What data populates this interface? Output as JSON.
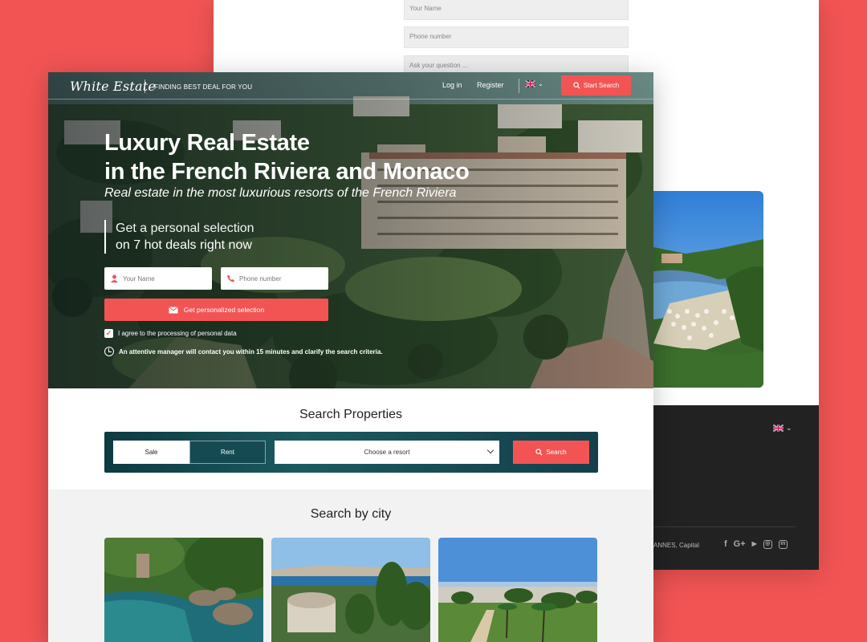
{
  "back_page": {
    "form": {
      "name_placeholder": "Your Name",
      "phone_placeholder": "Phone number",
      "question_placeholder": "Ask your question ..."
    },
    "footer": {
      "address_fragment": "ANNES, Capital",
      "social_icons": [
        "facebook-icon",
        "google-plus-icon",
        "youtube-icon",
        "instagram-icon",
        "linkedin-icon"
      ]
    }
  },
  "header": {
    "logo": "White Estate",
    "tagline": "FINDING BEST DEAL FOR YOU",
    "login": "Log in",
    "register": "Register",
    "language_flag": "uk-flag-icon",
    "start_search": "Start Search"
  },
  "hero": {
    "title_line1": "Luxury Real Estate",
    "title_line2": "in the French Riviera and Monaco",
    "subtitle": "Real estate in the most luxurious resorts of the French Riviera",
    "pitch_line1": "Get a personal selection",
    "pitch_line2": "on 7 hot deals right now",
    "name_placeholder": "Your Name",
    "phone_placeholder": "Phone number",
    "cta": "Get personalized selection",
    "agree": "I agree to the processing of personal data",
    "agree_checked": true,
    "notice": "An attentive manager will contact you within 15 minutes and clarify the search criteria."
  },
  "search": {
    "title": "Search Properties",
    "tab_sale": "Sale",
    "tab_rent": "Rent",
    "resort_select": "Choose a resort",
    "button": "Search"
  },
  "cities": {
    "title": "Search by city"
  },
  "colors": {
    "accent": "#f25454",
    "dark_footer": "#222222",
    "search_bar": "#0d3b42"
  }
}
